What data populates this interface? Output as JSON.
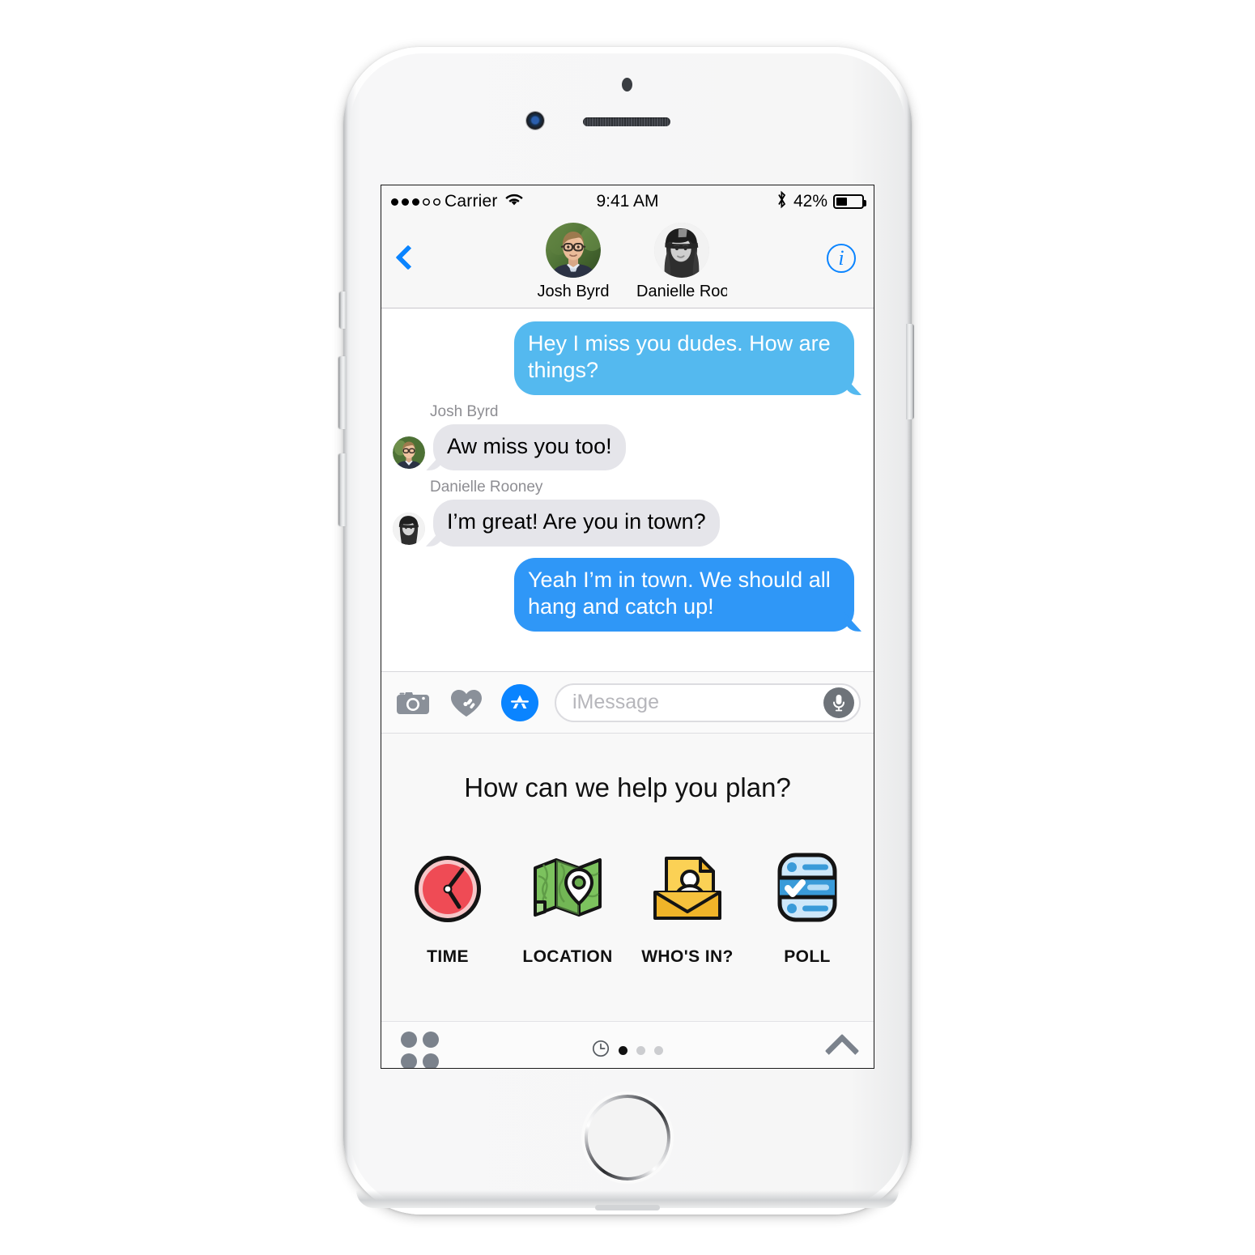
{
  "device": {
    "name": "iphone-white",
    "home_button": "home-button"
  },
  "status_bar": {
    "carrier": "Carrier",
    "signal_filled": 3,
    "signal_empty": 2,
    "wifi_icon": "wifi-icon",
    "time": "9:41 AM",
    "bluetooth_icon": "bluetooth-icon",
    "battery_percent": "42%",
    "battery_level": 42
  },
  "navbar": {
    "back_icon": "back-chevron-icon",
    "info_icon": "info-icon",
    "info_label": "i",
    "contacts": [
      {
        "name": "Josh Byrd",
        "avatar": "josh-byrd-avatar"
      },
      {
        "name": "Danielle Roo…",
        "avatar": "danielle-rooney-avatar"
      }
    ]
  },
  "conversation": {
    "messages": [
      {
        "direction": "outgoing",
        "text": "Hey I miss you dudes. How are things?",
        "color": "#54b9ef",
        "sender": "",
        "avatar": ""
      },
      {
        "direction": "incoming",
        "sender": "Josh Byrd",
        "text": "Aw miss you too!",
        "color": "#e5e5ea",
        "avatar": "josh-byrd-avatar"
      },
      {
        "direction": "incoming",
        "sender": "Danielle Rooney",
        "text": "I’m great! Are you in town?",
        "color": "#e5e5ea",
        "avatar": "danielle-rooney-avatar"
      },
      {
        "direction": "outgoing",
        "text": "Yeah I’m in town. We should all hang and catch up!",
        "color": "#2f97f7",
        "sender": "",
        "avatar": ""
      }
    ]
  },
  "input_bar": {
    "camera_icon": "camera-icon",
    "digital_touch_icon": "digital-touch-heart-icon",
    "app_store_icon": "app-store-icon",
    "placeholder": "iMessage",
    "value": "",
    "mic_icon": "microphone-icon"
  },
  "app_panel": {
    "title": "How can we help you plan?",
    "options": [
      {
        "label": "TIME",
        "icon": "clock-icon",
        "color": "#ef4b55"
      },
      {
        "label": "LOCATION",
        "icon": "map-icon",
        "color": "#6bbf59"
      },
      {
        "label": "WHO'S IN?",
        "icon": "envelope-icon",
        "color": "#f0b429"
      },
      {
        "label": "POLL",
        "icon": "poll-icon",
        "color": "#3a9bd9"
      }
    ]
  },
  "app_footer": {
    "grid_icon": "app-grid-icon",
    "recents_icon": "recents-clock-icon",
    "pages": 3,
    "active_page": 1,
    "expand_icon": "chevron-up-icon"
  },
  "theme": {
    "accent_blue": "#0a84ff",
    "bubble_in": "#e5e5ea",
    "bar_gray": "#f7f7f7",
    "label_gray": "#8e8e93"
  }
}
